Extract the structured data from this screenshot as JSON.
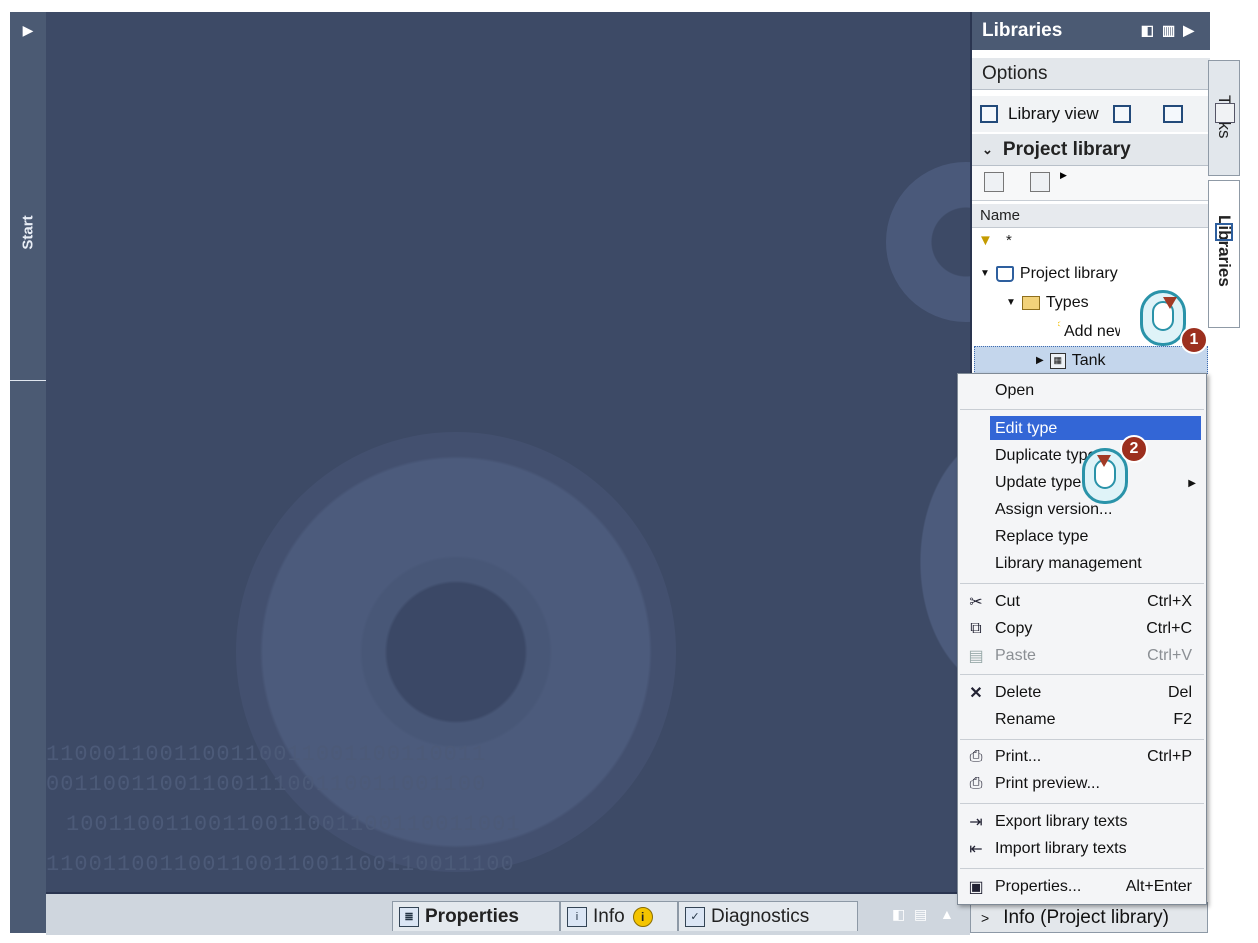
{
  "startbar": {
    "label": "Start"
  },
  "libraries_panel": {
    "title": "Libraries",
    "options_label": "Options",
    "library_view_label": "Library view",
    "project_library_header": "Project library",
    "name_column": "Name",
    "filter_text": "*",
    "tree": [
      {
        "label": "Project library",
        "kind": "library"
      },
      {
        "label": "Types",
        "kind": "folder"
      },
      {
        "label": "Add new type",
        "kind": "action"
      },
      {
        "label": "Tank",
        "kind": "type",
        "selected": true
      }
    ],
    "info_section": "Info (Project library)"
  },
  "side_tabs": {
    "tasks": "Tasks",
    "libraries": "Libraries"
  },
  "bottom_tabs": {
    "properties": "Properties",
    "info": "Info",
    "diagnostics": "Diagnostics"
  },
  "context_menu": {
    "items": [
      {
        "label": "Open",
        "shortcut": "",
        "icon": ""
      },
      {
        "label": "Edit type",
        "shortcut": "",
        "icon": "",
        "highlighted": true
      },
      {
        "label": "Duplicate type",
        "shortcut": "",
        "icon": ""
      },
      {
        "label": "Update type",
        "shortcut": "",
        "icon": "",
        "submenu": true
      },
      {
        "label": "Assign version...",
        "shortcut": "",
        "icon": ""
      },
      {
        "label": "Replace type",
        "shortcut": "",
        "icon": ""
      },
      {
        "label": "Library management",
        "shortcut": "",
        "icon": ""
      },
      {
        "label": "Cut",
        "shortcut": "Ctrl+X",
        "icon": "scissors-icon"
      },
      {
        "label": "Copy",
        "shortcut": "Ctrl+C",
        "icon": "copy-icon"
      },
      {
        "label": "Paste",
        "shortcut": "Ctrl+V",
        "icon": "paste-icon",
        "disabled": true
      },
      {
        "label": "Delete",
        "shortcut": "Del",
        "icon": "delete-icon"
      },
      {
        "label": "Rename",
        "shortcut": "F2",
        "icon": ""
      },
      {
        "label": "Print...",
        "shortcut": "Ctrl+P",
        "icon": "print-icon"
      },
      {
        "label": "Print preview...",
        "shortcut": "",
        "icon": "print-preview-icon"
      },
      {
        "label": "Export library texts",
        "shortcut": "",
        "icon": "export-icon"
      },
      {
        "label": "Import library texts",
        "shortcut": "",
        "icon": "import-icon"
      },
      {
        "label": "Properties...",
        "shortcut": "Alt+Enter",
        "icon": "properties-icon"
      }
    ]
  },
  "callouts": {
    "step1": "1",
    "step2": "2"
  },
  "colors": {
    "portal_bg": "#3d4a66",
    "panel_header": "#4b5a73",
    "highlight": "#3366d6",
    "callout": "#9c2f1e"
  }
}
